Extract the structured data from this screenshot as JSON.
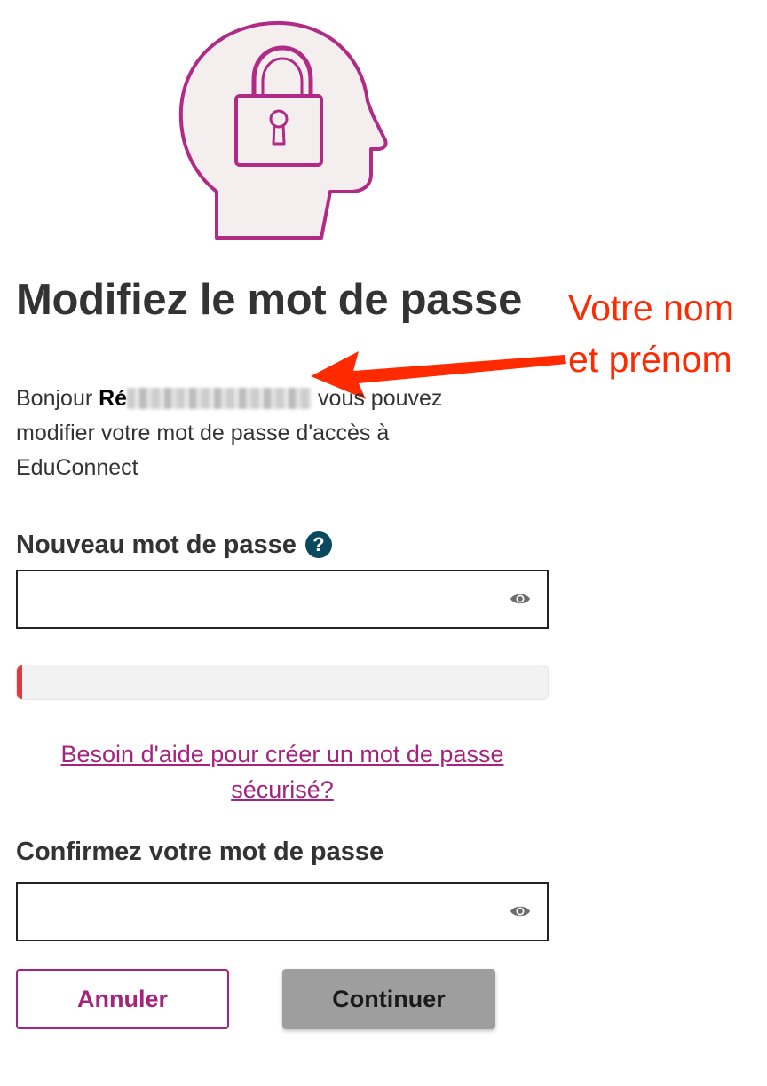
{
  "colors": {
    "accent": "#a3237e",
    "title": "#333333",
    "annotation": "#ff2a00",
    "help_icon_bg": "#0b4a5e",
    "strength_weak": "#e0393e",
    "continue_bg": "#9e9e9e"
  },
  "illustration": {
    "icon": "head-padlock-icon"
  },
  "page": {
    "title": "Modifiez le mot de passe"
  },
  "annotation": {
    "line1": "Votre nom",
    "line2": "et prénom"
  },
  "intro": {
    "greeting": "Bonjour",
    "name_visible": "Ré",
    "rest": " vous pouvez modifier votre mot de passe d'accès à EduConnect"
  },
  "new_password": {
    "label": "Nouveau mot de passe",
    "help_icon": "question-icon",
    "value": "",
    "reveal_icon": "eye-icon"
  },
  "strength": {
    "level": 0.01
  },
  "help_link": {
    "line1": "Besoin d'aide pour créer un mot de passe",
    "line2": "sécurisé?"
  },
  "confirm_password": {
    "label": "Confirmez votre mot de passe",
    "value": "",
    "reveal_icon": "eye-icon"
  },
  "buttons": {
    "cancel": "Annuler",
    "continue": "Continuer"
  }
}
